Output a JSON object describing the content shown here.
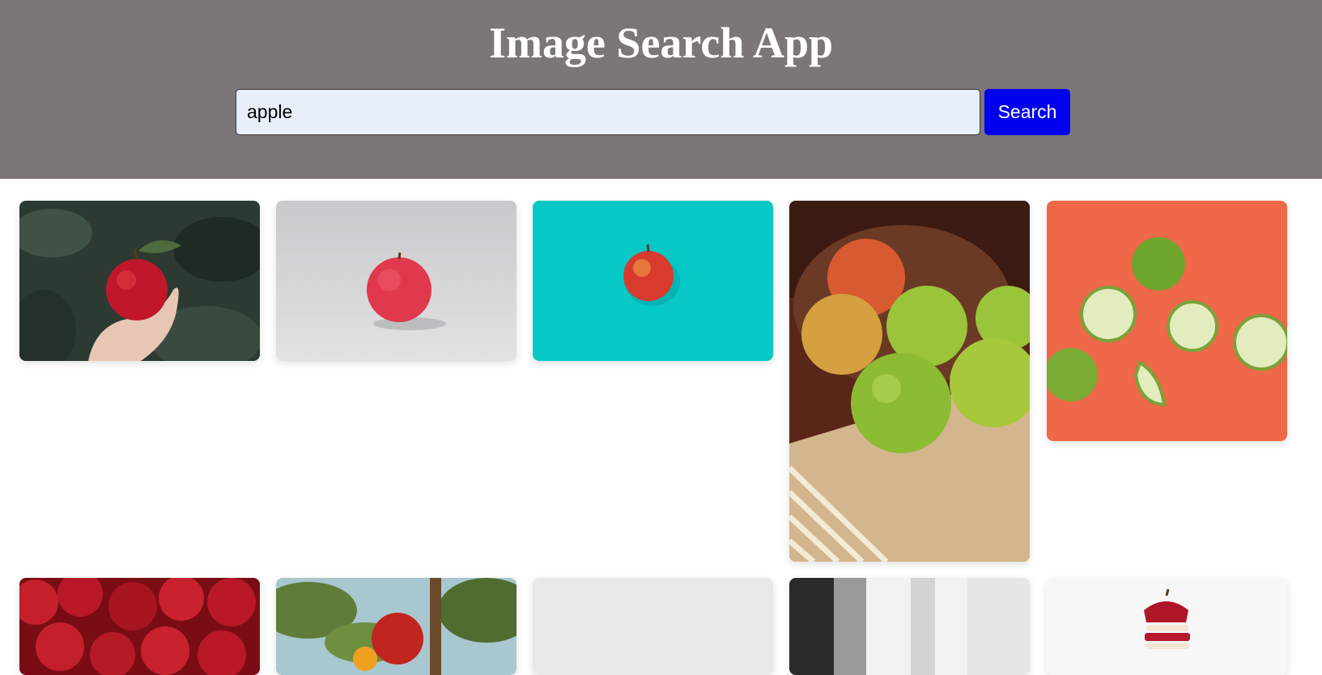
{
  "header": {
    "title": "Image Search App",
    "background": "#7b7677"
  },
  "search": {
    "value": "apple",
    "button_label": "Search",
    "button_color": "#0000ee",
    "input_background": "#e8effb"
  },
  "results": [
    {
      "subject": "red apple held in hand against dark foliage"
    },
    {
      "subject": "red apple on light grey background"
    },
    {
      "subject": "red apple on turquoise background"
    },
    {
      "subject": "bowl of red and green apples on striped cloth"
    },
    {
      "subject": "green apples and apple slices on orange background"
    },
    {
      "subject": "pile of red apples"
    },
    {
      "subject": "red apple growing on tree"
    },
    {
      "subject": "plain light grey background"
    },
    {
      "subject": "blurred black and white interior"
    },
    {
      "subject": "sliced red apple floating on white background"
    }
  ]
}
